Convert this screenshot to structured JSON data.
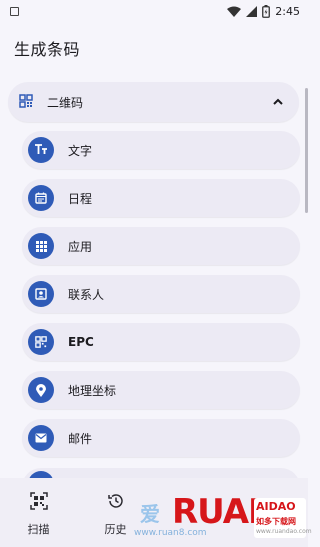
{
  "status": {
    "time": "2:45"
  },
  "title": "生成条码",
  "qr_group": {
    "label": "二维码",
    "expanded": true
  },
  "items": [
    {
      "label": "文字",
      "icon": "text-fields-icon"
    },
    {
      "label": "日程",
      "icon": "calendar-event-icon"
    },
    {
      "label": "应用",
      "icon": "apps-grid-icon"
    },
    {
      "label": "联系人",
      "icon": "contact-card-icon"
    },
    {
      "label": "EPC",
      "icon": "qr-code-icon"
    },
    {
      "label": "地理坐标",
      "icon": "location-pin-icon"
    },
    {
      "label": "邮件",
      "icon": "email-icon"
    }
  ],
  "bottom_nav": [
    {
      "label": "扫描",
      "icon": "qr-scan-icon"
    },
    {
      "label": "历史",
      "icon": "history-icon"
    }
  ],
  "watermark": {
    "cn": "爱",
    "logo": "RUAN",
    "badge_top": "AIDAO",
    "badge_mid": "如多下载网",
    "badge_small": "www.ruandao.com",
    "url": "www.ruan8.com"
  },
  "colors": {
    "accent": "#2f5bb7",
    "background": "#f6f5fb",
    "card": "#eceaf4"
  }
}
